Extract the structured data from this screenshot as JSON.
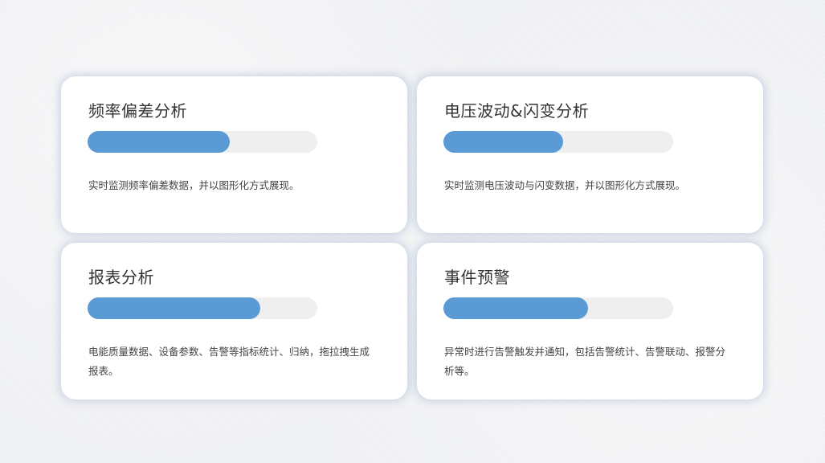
{
  "colors": {
    "bar_fill": "#5b9bd5",
    "bar_track": "#efefef",
    "card_bg": "#ffffff",
    "page_bg": "#f1f2f4"
  },
  "cards": [
    {
      "title": "频率偏差分析",
      "progress": 0.62,
      "description": "实时监测频率偏差数据，并以图形化方式展现。"
    },
    {
      "title": "电压波动&闪变分析",
      "progress": 0.52,
      "description": "实时监测电压波动与闪变数据，并以图形化方式展现。"
    },
    {
      "title": "报表分析",
      "progress": 0.75,
      "description": "电能质量数据、设备参数、告警等指标统计、归纳，拖拉拽生成报表。"
    },
    {
      "title": "事件预警",
      "progress": 0.63,
      "description": "异常时进行告警触发并通知，包括告警统计、告警联动、报警分析等。"
    }
  ]
}
